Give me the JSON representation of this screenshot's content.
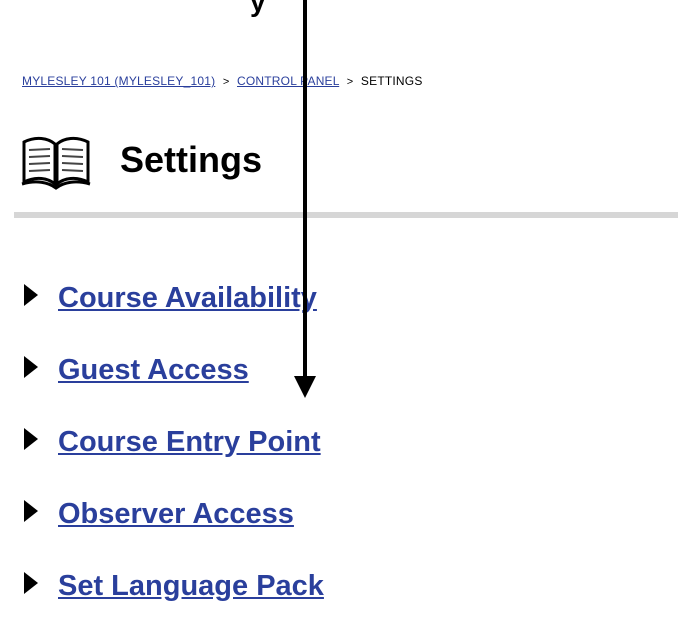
{
  "partial_top_text": "y",
  "breadcrumb": {
    "course": "MYLESLEY 101 (MYLESLEY_101)",
    "control_panel": "CONTROL PANEL",
    "current": "SETTINGS",
    "separator": ">"
  },
  "header": {
    "title": "Settings",
    "icon": "open-book-icon"
  },
  "settings": [
    {
      "label": "Course Availability"
    },
    {
      "label": "Guest Access"
    },
    {
      "label": "Course Entry Point"
    },
    {
      "label": "Observer Access"
    },
    {
      "label": "Set Language Pack"
    }
  ],
  "colors": {
    "link": "#2a3f9c",
    "divider": "#d6d6d6",
    "text": "#000000"
  }
}
